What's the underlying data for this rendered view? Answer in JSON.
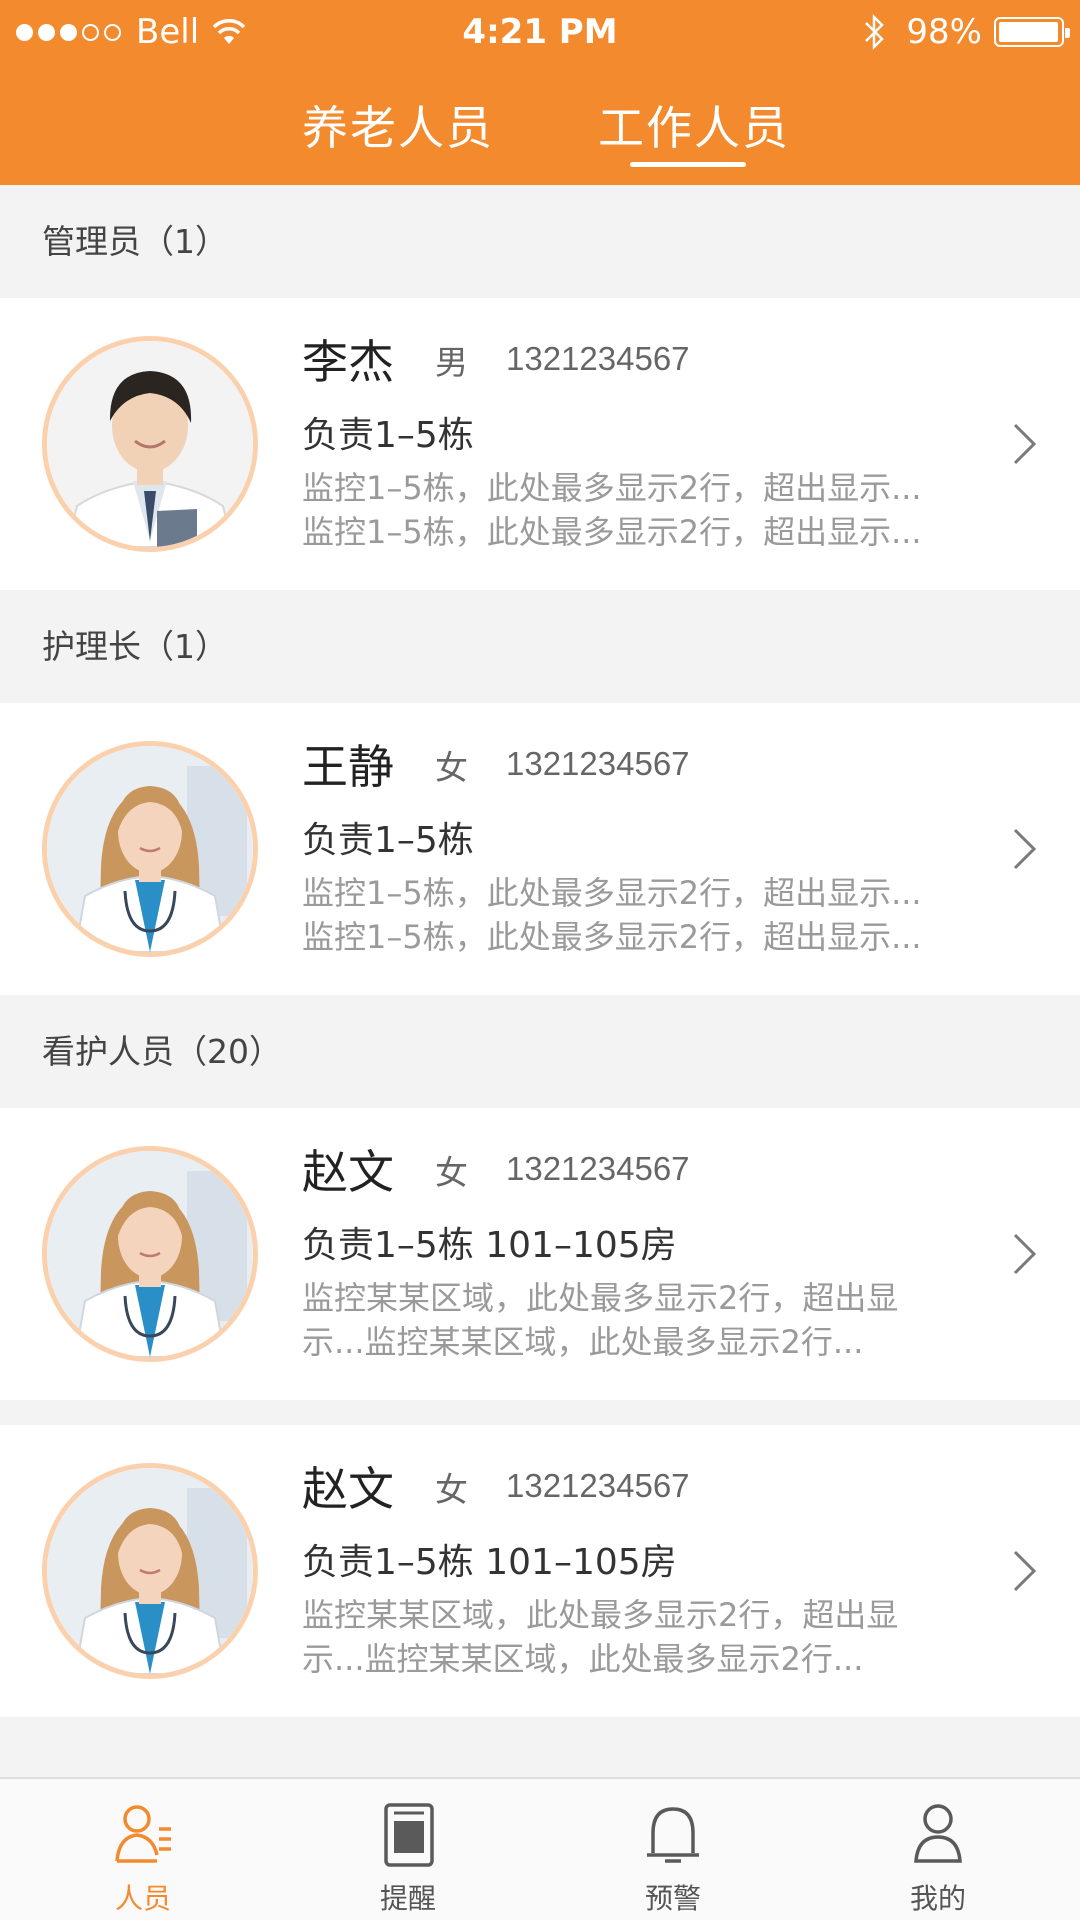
{
  "status_bar": {
    "carrier": "Bell",
    "time": "4:21 PM",
    "battery": "98%",
    "battery_level": 0.98
  },
  "tabs": [
    {
      "label": "养老人员",
      "active": false
    },
    {
      "label": "工作人员",
      "active": true
    }
  ],
  "sections": [
    {
      "title": "管理员（1）",
      "people": [
        {
          "name": "李杰",
          "gender": "男",
          "phone": "1321234567",
          "duty": "负责1–5栋",
          "desc_line1": "监控1–5栋，此处最多显示2行，超出显示...",
          "desc_line2": "监控1–5栋，此处最多显示2行，超出显示...",
          "avatar": "male-doctor"
        }
      ]
    },
    {
      "title": "护理长（1）",
      "people": [
        {
          "name": "王静",
          "gender": "女",
          "phone": "1321234567",
          "duty": "负责1–5栋",
          "desc_line1": "监控1–5栋，此处最多显示2行，超出显示...",
          "desc_line2": "监控1–5栋，此处最多显示2行，超出显示...",
          "avatar": "female-doctor"
        }
      ]
    },
    {
      "title": "看护人员（20）",
      "people": [
        {
          "name": "赵文",
          "gender": "女",
          "phone": "1321234567",
          "duty": "负责1–5栋  101–105房",
          "desc_line1": "监控某某区域，此处最多显示2行，超出显",
          "desc_line2": "示...监控某某区域，此处最多显示2行...",
          "avatar": "female-doctor"
        },
        {
          "name": "赵文",
          "gender": "女",
          "phone": "1321234567",
          "duty": "负责1–5栋  101–105房",
          "desc_line1": "监控某某区域，此处最多显示2行，超出显",
          "desc_line2": "示...监控某某区域，此处最多显示2行...",
          "avatar": "female-doctor"
        }
      ]
    }
  ],
  "bottom_nav": [
    {
      "label": "人员",
      "icon": "person-list-icon",
      "active": true
    },
    {
      "label": "提醒",
      "icon": "notebook-icon",
      "active": false
    },
    {
      "label": "预警",
      "icon": "bell-icon",
      "active": false
    },
    {
      "label": "我的",
      "icon": "profile-icon",
      "active": false
    }
  ],
  "colors": {
    "accent": "#f38a2e",
    "avatar_ring": "#fbd1ad",
    "background": "#f3f3f3"
  }
}
